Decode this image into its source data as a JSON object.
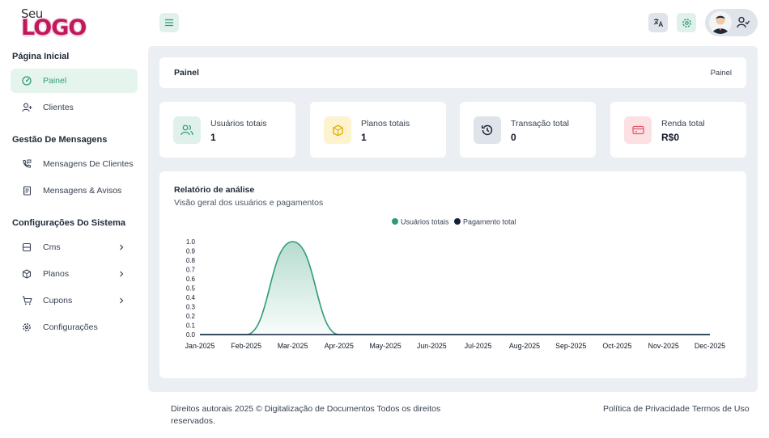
{
  "logo": {
    "top": "Seu",
    "word": "LOGO"
  },
  "sidebar": {
    "sections": [
      {
        "title": "Página Inicial"
      },
      {
        "title": "Gestão De Mensagens"
      },
      {
        "title": "Configurações Do Sistema"
      }
    ],
    "items": [
      {
        "label": "Painel",
        "icon": "dashboard-icon"
      },
      {
        "label": "Clientes",
        "icon": "user-plus-icon"
      },
      {
        "label": "Mensagens De Clientes",
        "icon": "phone-message-icon"
      },
      {
        "label": "Mensagens & Avisos",
        "icon": "notes-icon"
      },
      {
        "label": "Cms",
        "icon": "cms-icon"
      },
      {
        "label": "Planos",
        "icon": "box-icon"
      },
      {
        "label": "Cupons",
        "icon": "cart-icon"
      },
      {
        "label": "Configurações",
        "icon": "gear-icon"
      }
    ]
  },
  "header": {
    "title": "Painel",
    "breadcrumb": "Painel"
  },
  "stats": [
    {
      "label": "Usuários totais",
      "value": "1",
      "icon": "users-icon",
      "color": "#2f9b76",
      "bg": "#dff1ea"
    },
    {
      "label": "Planos totais",
      "value": "1",
      "icon": "box-icon",
      "color": "#e2b100",
      "bg": "#fdf3cf"
    },
    {
      "label": "Transação total",
      "value": "0",
      "icon": "history-icon",
      "color": "#1f2937",
      "bg": "#dfe3ea"
    },
    {
      "label": "Renda total",
      "value": "R$0",
      "icon": "credit-card-icon",
      "color": "#e2566b",
      "bg": "#fde0e3"
    }
  ],
  "report": {
    "title": "Relatório de análise",
    "subtitle": "Visão geral dos usuários e pagamentos"
  },
  "chart_data": {
    "type": "area",
    "categories": [
      "Jan-2025",
      "Feb-2025",
      "Mar-2025",
      "Apr-2025",
      "May-2025",
      "Jun-2025",
      "Jul-2025",
      "Aug-2025",
      "Sep-2025",
      "Oct-2025",
      "Nov-2025",
      "Dec-2025"
    ],
    "series": [
      {
        "name": "Usuários totais",
        "color": "#2f9b76",
        "values": [
          0,
          0,
          1,
          0,
          0,
          0,
          0,
          0,
          0,
          0,
          0,
          0
        ]
      },
      {
        "name": "Pagamento total",
        "color": "#14213d",
        "values": [
          0,
          0,
          0,
          0,
          0,
          0,
          0,
          0,
          0,
          0,
          0,
          0
        ]
      }
    ],
    "yticks": [
      "0.0",
      "0.1",
      "0.2",
      "0.3",
      "0.4",
      "0.5",
      "0.6",
      "0.7",
      "0.8",
      "0.9",
      "1.0"
    ],
    "ylim": [
      0,
      1
    ],
    "legend": "top-center",
    "grid": false
  },
  "footer": {
    "copyright_line1": "Direitos autorais 2025 © Digitalização de Documentos Todos os direitos",
    "copyright_line2": "reservados.",
    "privacy": "Política de Privacidade",
    "terms": "Termos de Uso"
  },
  "colors": {
    "accent": "#2f9b76",
    "background": "#ebeff3"
  }
}
